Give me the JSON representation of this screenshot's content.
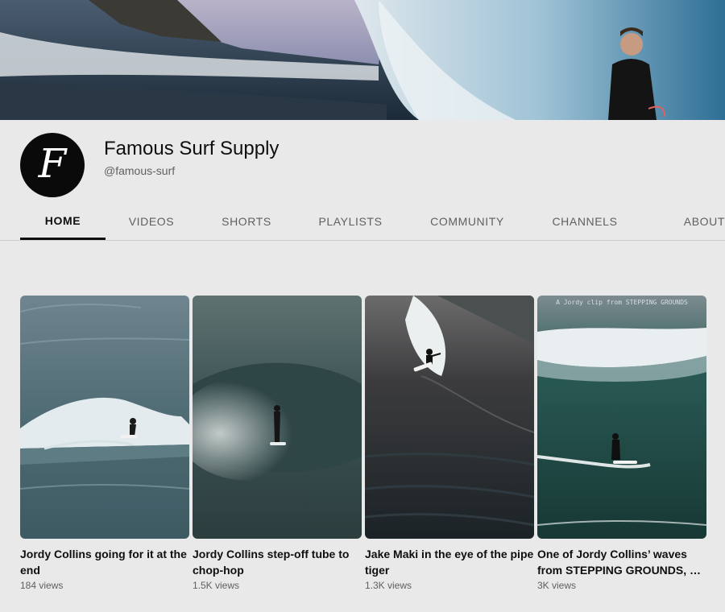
{
  "channel": {
    "name": "Famous Surf Supply",
    "handle": "@famous-surf",
    "avatar_letter": "F"
  },
  "tabs": [
    {
      "label": "HOME",
      "active": true
    },
    {
      "label": "VIDEOS",
      "active": false
    },
    {
      "label": "SHORTS",
      "active": false
    },
    {
      "label": "PLAYLISTS",
      "active": false
    },
    {
      "label": "COMMUNITY",
      "active": false
    },
    {
      "label": "CHANNELS",
      "active": false
    },
    {
      "label": "ABOUT",
      "active": false
    }
  ],
  "shorts": [
    {
      "title": "Jordy Collins going for it at the end",
      "views": "184 views"
    },
    {
      "title": "Jordy Collins step-off tube to chop-hop",
      "views": "1.5K views"
    },
    {
      "title": "Jake Maki in the eye of the pipe tiger",
      "views": "1.3K views"
    },
    {
      "title": "One of Jordy Collins’ waves from STEPPING GROUNDS, …",
      "views": "3K views",
      "overlay": "A Jordy clip from STEPPING GROUNDS"
    }
  ]
}
